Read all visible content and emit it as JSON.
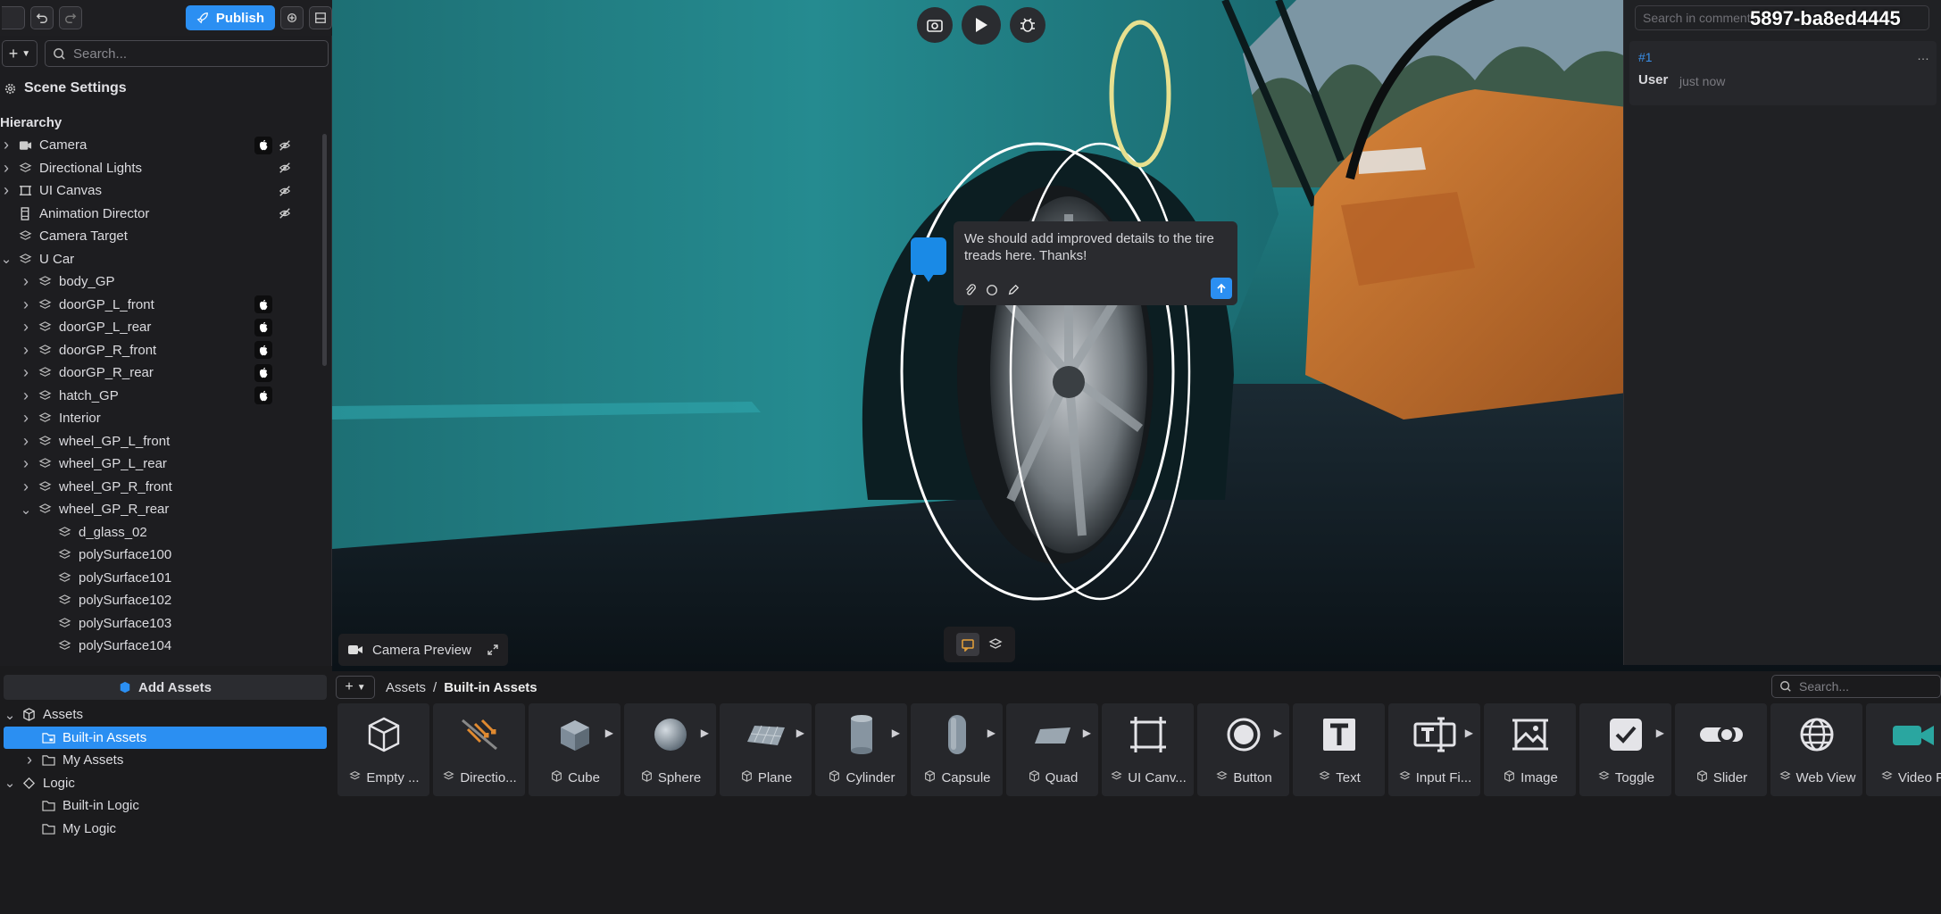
{
  "toolbar": {
    "publish_label": "Publish"
  },
  "left": {
    "search_placeholder": "Search...",
    "scene_settings": "Scene Settings",
    "hierarchy_title": "Hierarchy",
    "tree": [
      {
        "label": "Camera",
        "icon": "camera-icon",
        "depth": 0,
        "arrow": "right",
        "apple": true,
        "hide": true
      },
      {
        "label": "Directional Lights",
        "icon": "layers-icon",
        "depth": 0,
        "arrow": "right",
        "apple": false,
        "hide": true
      },
      {
        "label": "UI Canvas",
        "icon": "frame-icon",
        "depth": 0,
        "arrow": "right",
        "apple": false,
        "hide": true
      },
      {
        "label": "Animation Director",
        "icon": "film-icon",
        "depth": 0,
        "arrow": "none",
        "apple": false,
        "hide": true
      },
      {
        "label": "Camera Target",
        "icon": "layers-icon",
        "depth": 0,
        "arrow": "none",
        "apple": false,
        "hide": false
      },
      {
        "label": "U Car",
        "icon": "layers-icon",
        "depth": 0,
        "arrow": "down",
        "apple": false,
        "hide": false
      },
      {
        "label": "body_GP",
        "icon": "layers-icon",
        "depth": 1,
        "arrow": "right",
        "apple": false,
        "hide": false
      },
      {
        "label": "doorGP_L_front",
        "icon": "layers-icon",
        "depth": 1,
        "arrow": "right",
        "apple": true,
        "hide": false
      },
      {
        "label": "doorGP_L_rear",
        "icon": "layers-icon",
        "depth": 1,
        "arrow": "right",
        "apple": true,
        "hide": false
      },
      {
        "label": "doorGP_R_front",
        "icon": "layers-icon",
        "depth": 1,
        "arrow": "right",
        "apple": true,
        "hide": false
      },
      {
        "label": "doorGP_R_rear",
        "icon": "layers-icon",
        "depth": 1,
        "arrow": "right",
        "apple": true,
        "hide": false
      },
      {
        "label": "hatch_GP",
        "icon": "layers-icon",
        "depth": 1,
        "arrow": "right",
        "apple": true,
        "hide": false
      },
      {
        "label": "Interior",
        "icon": "layers-icon",
        "depth": 1,
        "arrow": "right",
        "apple": false,
        "hide": false
      },
      {
        "label": "wheel_GP_L_front",
        "icon": "layers-icon",
        "depth": 1,
        "arrow": "right",
        "apple": false,
        "hide": false
      },
      {
        "label": "wheel_GP_L_rear",
        "icon": "layers-icon",
        "depth": 1,
        "arrow": "right",
        "apple": false,
        "hide": false
      },
      {
        "label": "wheel_GP_R_front",
        "icon": "layers-icon",
        "depth": 1,
        "arrow": "right",
        "apple": false,
        "hide": false
      },
      {
        "label": "wheel_GP_R_rear",
        "icon": "layers-icon",
        "depth": 1,
        "arrow": "down",
        "apple": false,
        "hide": false
      },
      {
        "label": "d_glass_02",
        "icon": "layers-icon",
        "depth": 2,
        "arrow": "none",
        "apple": false,
        "hide": false
      },
      {
        "label": "polySurface100",
        "icon": "layers-icon",
        "depth": 2,
        "arrow": "none",
        "apple": false,
        "hide": false
      },
      {
        "label": "polySurface101",
        "icon": "layers-icon",
        "depth": 2,
        "arrow": "none",
        "apple": false,
        "hide": false
      },
      {
        "label": "polySurface102",
        "icon": "layers-icon",
        "depth": 2,
        "arrow": "none",
        "apple": false,
        "hide": false
      },
      {
        "label": "polySurface103",
        "icon": "layers-icon",
        "depth": 2,
        "arrow": "none",
        "apple": false,
        "hide": false
      },
      {
        "label": "polySurface104",
        "icon": "layers-icon",
        "depth": 2,
        "arrow": "none",
        "apple": false,
        "hide": false
      }
    ]
  },
  "viewport": {
    "camera_preview": "Camera Preview",
    "comment_text": "We should add improved details to the tire treads here. Thanks!"
  },
  "comments": {
    "search_placeholder": "Search in comments",
    "session_id": "5897-ba8ed4445",
    "items": [
      {
        "number": "#1",
        "user": "User",
        "time": "just now"
      }
    ]
  },
  "assets": {
    "add_label": "Add Assets",
    "tree": [
      {
        "label": "Assets",
        "depth": 0,
        "arrow": "down",
        "icon": "cube-icon",
        "selected": false
      },
      {
        "label": "Built-in Assets",
        "depth": 1,
        "arrow": "none",
        "icon": "folder-lock-icon",
        "selected": true
      },
      {
        "label": "My Assets",
        "depth": 1,
        "arrow": "right",
        "icon": "folder-icon",
        "selected": false
      },
      {
        "label": "Logic",
        "depth": 0,
        "arrow": "down",
        "icon": "logic-icon",
        "selected": false
      },
      {
        "label": "Built-in Logic",
        "depth": 1,
        "arrow": "none",
        "icon": "folder-icon",
        "selected": false
      },
      {
        "label": "My Logic",
        "depth": 1,
        "arrow": "none",
        "icon": "folder-icon",
        "selected": false
      }
    ],
    "breadcrumb": [
      "Assets",
      "/",
      "Built-in Assets"
    ],
    "search_placeholder": "Search...",
    "items": [
      {
        "label": "Empty ...",
        "icon": "empty-cube-icon",
        "arrow": false
      },
      {
        "label": "Directio...",
        "icon": "directional-light-icon",
        "arrow": false
      },
      {
        "label": "Cube",
        "icon": "cube-icon",
        "arrow": true
      },
      {
        "label": "Sphere",
        "icon": "sphere-icon",
        "arrow": true
      },
      {
        "label": "Plane",
        "icon": "plane-icon",
        "arrow": true
      },
      {
        "label": "Cylinder",
        "icon": "cylinder-icon",
        "arrow": true
      },
      {
        "label": "Capsule",
        "icon": "capsule-icon",
        "arrow": true
      },
      {
        "label": "Quad",
        "icon": "quad-icon",
        "arrow": true
      },
      {
        "label": "UI Canv...",
        "icon": "ui-canvas-icon",
        "arrow": false
      },
      {
        "label": "Button",
        "icon": "button-icon",
        "arrow": true
      },
      {
        "label": "Text",
        "icon": "text-icon",
        "arrow": false
      },
      {
        "label": "Input Fi...",
        "icon": "input-field-icon",
        "arrow": true
      },
      {
        "label": "Image",
        "icon": "image-icon",
        "arrow": false
      },
      {
        "label": "Toggle",
        "icon": "toggle-icon",
        "arrow": true
      },
      {
        "label": "Slider",
        "icon": "slider-icon",
        "arrow": false
      },
      {
        "label": "Web View",
        "icon": "globe-icon",
        "arrow": false
      },
      {
        "label": "Video P",
        "icon": "video-icon",
        "arrow": false
      }
    ]
  },
  "colors": {
    "accent": "#2b8ff2",
    "panel": "#1d1d20",
    "car_body": "#1f7a7f",
    "door": "#c8722a"
  }
}
